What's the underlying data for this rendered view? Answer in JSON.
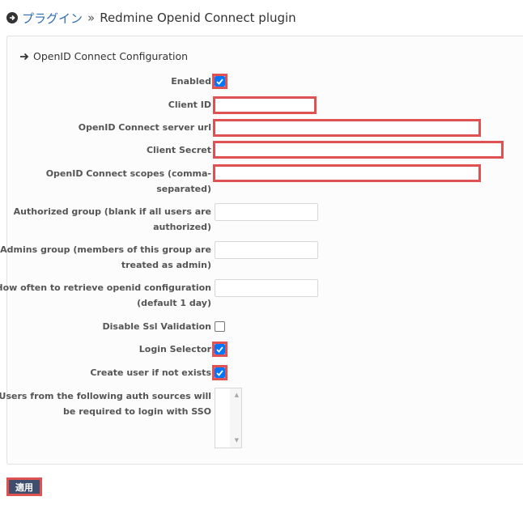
{
  "breadcrumb": {
    "icon": "circle-arrow-right-icon",
    "link": "プラグイン",
    "separator": "»",
    "title": "Redmine Openid Connect plugin"
  },
  "section": {
    "icon": "arrow-right-icon",
    "title": "OpenID Connect Configuration"
  },
  "fields": {
    "enabled": {
      "label": "Enabled",
      "checked": true
    },
    "client_id": {
      "label": "Client ID",
      "value": ""
    },
    "server_url": {
      "label": "OpenID Connect server url",
      "value": ""
    },
    "client_secret": {
      "label": "Client Secret",
      "value": ""
    },
    "scopes": {
      "label_line1": "OpenID Connect scopes (comma-",
      "label_line2": "separated)",
      "value": ""
    },
    "authorized_group": {
      "label_line1": "Authorized group (blank if all users are",
      "label_line2": "authorized)",
      "value": ""
    },
    "admins_group": {
      "label_line1": "Admins group (members of this group are",
      "label_line2": "treated as admin)",
      "value": ""
    },
    "retrieve_interval": {
      "label_line1": "How often to retrieve openid configuration",
      "label_line2": "(default 1 day)",
      "value": ""
    },
    "disable_ssl": {
      "label": "Disable Ssl Validation",
      "checked": false
    },
    "login_selector": {
      "label": "Login Selector",
      "checked": true
    },
    "create_user": {
      "label": "Create user if not exists",
      "checked": true
    },
    "auth_sources": {
      "label_line1": "Users from the following auth sources will",
      "label_line2": "be required to login with SSO",
      "options": []
    }
  },
  "submit_label": "適用",
  "colors": {
    "link": "#2e6db4",
    "highlight": "#e05252",
    "button": "#3f4e6d",
    "checkbox": "#0075ff"
  }
}
